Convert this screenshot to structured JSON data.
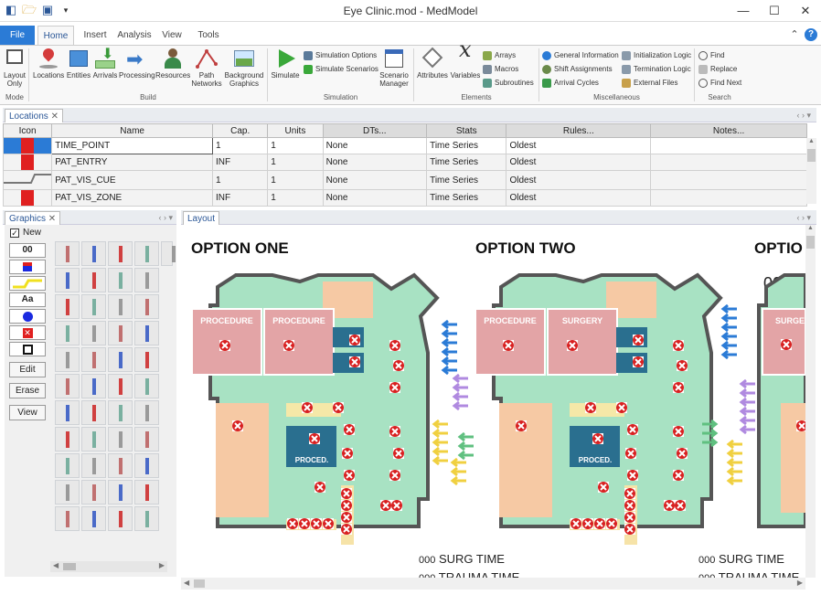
{
  "window": {
    "title": "Eye Clinic.mod - MedModel"
  },
  "ribbon": {
    "tabs": [
      "File",
      "Home",
      "Insert",
      "Analysis",
      "View",
      "Tools"
    ],
    "layout_only": "Layout Only",
    "build": [
      "Locations",
      "Entities",
      "Arrivals",
      "Processing",
      "Resources",
      "Path Networks",
      "Background Graphics"
    ],
    "simulate": "Simulate",
    "sim_small": [
      "Simulation Options",
      "Simulate Scenarios"
    ],
    "scenario_manager": "Scenario Manager",
    "elements_big": [
      "Attributes",
      "Variables"
    ],
    "elements_small": [
      "Arrays",
      "Macros",
      "Subroutines"
    ],
    "misc_col1": [
      "General Information",
      "Shift Assignments",
      "Arrival Cycles"
    ],
    "misc_col2": [
      "Initialization Logic",
      "Termination Logic",
      "External Files"
    ],
    "search": [
      "Find",
      "Replace",
      "Find Next"
    ],
    "groups": [
      "Mode",
      "Build",
      "Simulation",
      "Elements",
      "Miscellaneous",
      "Search"
    ]
  },
  "locations": {
    "tab": "Locations",
    "columns": [
      "Icon",
      "Name",
      "Cap.",
      "Units",
      "DTs...",
      "Stats",
      "Rules...",
      "Notes..."
    ],
    "rows": [
      {
        "name": "TIME_POINT",
        "cap": "1",
        "units": "1",
        "dts": "None",
        "stats": "Time Series",
        "rules": "Oldest"
      },
      {
        "name": "PAT_ENTRY",
        "cap": "INF",
        "units": "1",
        "dts": "None",
        "stats": "Time Series",
        "rules": "Oldest"
      },
      {
        "name": "PAT_VIS_CUE",
        "cap": "1",
        "units": "1",
        "dts": "None",
        "stats": "Time Series",
        "rules": "Oldest"
      },
      {
        "name": "PAT_VIS_ZONE",
        "cap": "INF",
        "units": "1",
        "dts": "None",
        "stats": "Time Series",
        "rules": "Oldest"
      }
    ]
  },
  "graphics": {
    "tab": "Graphics",
    "new_label": "New",
    "tool_counter": "00",
    "tool_text": "Aa",
    "buttons": [
      "Edit",
      "Erase",
      "View"
    ]
  },
  "layout": {
    "tab": "Layout",
    "options": [
      "OPTION ONE",
      "OPTION TWO",
      "OPTIO"
    ],
    "counter": "000",
    "option1_rooms": [
      "PROCEDURE",
      "PROCEDURE",
      "PROCED."
    ],
    "option2_rooms": [
      "PROCEDURE",
      "SURGERY",
      "PROCED."
    ],
    "option3_rooms": [
      "SURGER"
    ],
    "stats": [
      {
        "value": "000",
        "label": "SURG TIME"
      },
      {
        "value": "000",
        "label": "TRAUMA TIME"
      }
    ]
  },
  "colors": {
    "accent": "#2b7bd6",
    "floor": "#a8e2c3",
    "wall": "#555555",
    "procedure_room": "#e3a4a6",
    "waiting": "#f6c9a4",
    "proc_box": "#2a6f8f"
  }
}
